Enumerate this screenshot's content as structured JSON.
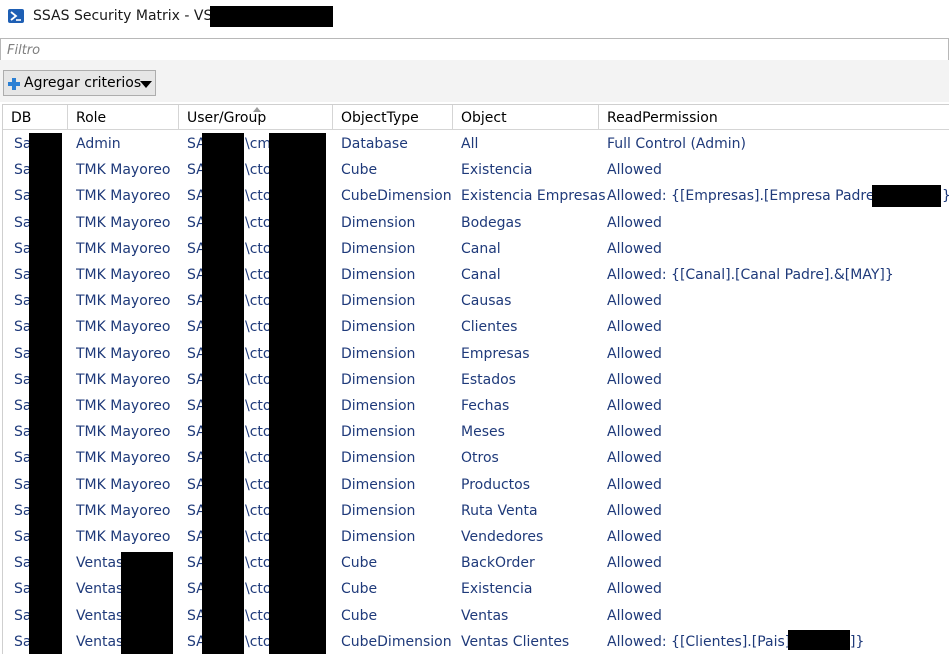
{
  "window": {
    "title": "SSAS Security Matrix - VSR"
  },
  "filter": {
    "placeholder": "Filtro",
    "value": ""
  },
  "toolbar": {
    "add_criteria_label": "Agregar criterios"
  },
  "table": {
    "columns": [
      "DB",
      "Role",
      "User/Group",
      "ObjectType",
      "Object",
      "ReadPermission"
    ],
    "sorted_column": "User/Group",
    "rows": [
      [
        "Sa",
        "Admin",
        "SA",
        "\\cm",
        "Database",
        "All",
        "Full Control (Admin)"
      ],
      [
        "Sa",
        "TMK Mayoreo",
        "SA",
        "\\cto",
        "Cube",
        "Existencia",
        "Allowed"
      ],
      [
        "Sa",
        "TMK Mayoreo",
        "SA",
        "\\cto",
        "CubeDimension",
        "Existencia Empresas",
        "Allowed: {[Empresas].[Empresa Padre].&["
      ],
      [
        "Sa",
        "TMK Mayoreo",
        "SA",
        "\\cto",
        "Dimension",
        "Bodegas",
        "Allowed"
      ],
      [
        "Sa",
        "TMK Mayoreo",
        "SA",
        "\\cto",
        "Dimension",
        "Canal",
        "Allowed"
      ],
      [
        "Sa",
        "TMK Mayoreo",
        "SA",
        "\\cto",
        "Dimension",
        "Canal",
        "Allowed: {[Canal].[Canal Padre].&[MAY]}"
      ],
      [
        "Sa",
        "TMK Mayoreo",
        "SA",
        "\\cto",
        "Dimension",
        "Causas",
        "Allowed"
      ],
      [
        "Sa",
        "TMK Mayoreo",
        "SA",
        "\\cto",
        "Dimension",
        "Clientes",
        "Allowed"
      ],
      [
        "Sa",
        "TMK Mayoreo",
        "SA",
        "\\cto",
        "Dimension",
        "Empresas",
        "Allowed"
      ],
      [
        "Sa",
        "TMK Mayoreo",
        "SA",
        "\\cto",
        "Dimension",
        "Estados",
        "Allowed"
      ],
      [
        "Sa",
        "TMK Mayoreo",
        "SA",
        "\\cto",
        "Dimension",
        "Fechas",
        "Allowed"
      ],
      [
        "Sa",
        "TMK Mayoreo",
        "SA",
        "\\cto",
        "Dimension",
        "Meses",
        "Allowed"
      ],
      [
        "Sa",
        "TMK Mayoreo",
        "SA",
        "\\cto",
        "Dimension",
        "Otros",
        "Allowed"
      ],
      [
        "Sa",
        "TMK Mayoreo",
        "SA",
        "\\cto",
        "Dimension",
        "Productos",
        "Allowed"
      ],
      [
        "Sa",
        "TMK Mayoreo",
        "SA",
        "\\cto",
        "Dimension",
        "Ruta Venta",
        "Allowed"
      ],
      [
        "Sa",
        "TMK Mayoreo",
        "SA",
        "\\cto",
        "Dimension",
        "Vendedores",
        "Allowed"
      ],
      [
        "Sa",
        "Ventas",
        "SA",
        "\\cto",
        "Cube",
        "BackOrder",
        "Allowed"
      ],
      [
        "Sa",
        "Ventas",
        "SA",
        "\\cto",
        "Cube",
        "Existencia",
        "Allowed"
      ],
      [
        "Sa",
        "Ventas",
        "SA",
        "\\cto",
        "Cube",
        "Ventas",
        "Allowed"
      ],
      [
        "Sa",
        "Ventas",
        "SA",
        "\\cto",
        "CubeDimension",
        "Ventas Clientes",
        "Allowed: {[Clientes].[Pais].&["
      ]
    ],
    "row_tail_suffixes": {
      "2": "}",
      "19": "]}"
    }
  },
  "colors": {
    "cell_text": "#1f3a7a",
    "accent": "#2a7fd4",
    "redaction": "#000000"
  },
  "icons": {
    "app": "powershell-icon",
    "add": "plus-icon",
    "dropdown": "caret-down-icon",
    "sort": "sort-ascending-icon"
  }
}
